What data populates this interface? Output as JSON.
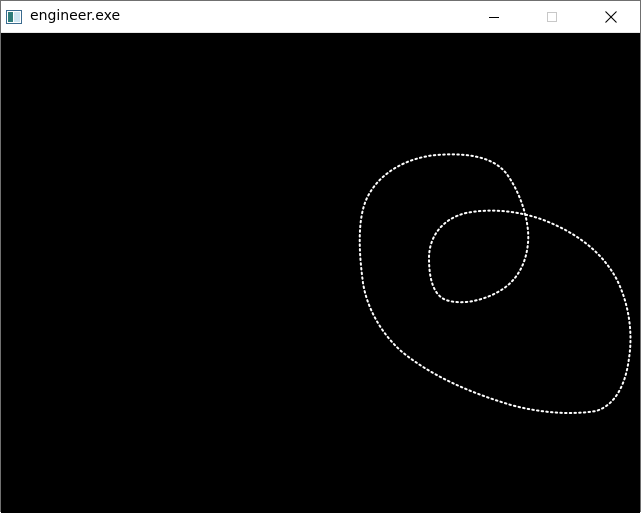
{
  "window": {
    "title": "engineer.exe",
    "app_icon": "application-window-icon",
    "controls": {
      "minimize": "minimize-icon",
      "maximize": "maximize-icon",
      "close": "close-icon"
    }
  },
  "canvas": {
    "background": "#000000",
    "stroke_color": "#ffffff",
    "shapes": [
      "outer-loop-curve",
      "inner-loop-curve"
    ]
  }
}
